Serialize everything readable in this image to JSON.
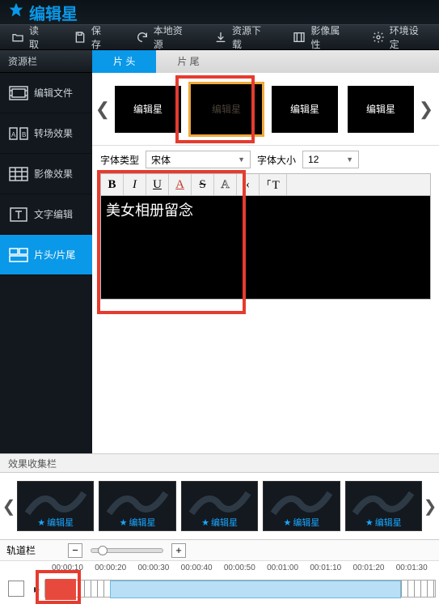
{
  "app": {
    "title": "编辑星"
  },
  "menu": {
    "read": "读 取",
    "save": "保 存",
    "localres": "本地资源",
    "download": "资源下载",
    "movieprops": "影像属性",
    "envset": "环境设定"
  },
  "sidebar": {
    "header": "资源栏",
    "items": [
      {
        "label": "编辑文件"
      },
      {
        "label": "转场效果"
      },
      {
        "label": "影像效果"
      },
      {
        "label": "文字编辑"
      },
      {
        "label": "片头/片尾"
      }
    ]
  },
  "tabs": {
    "head": "片 头",
    "tail": "片 尾"
  },
  "templates": {
    "t0": "编辑星",
    "t1": "编辑星",
    "t2": "编辑星",
    "t3": "编辑星"
  },
  "fontrow": {
    "type_label": "字体类型",
    "type_value": "宋体",
    "size_label": "字体大小",
    "size_value": "12"
  },
  "richtoolbar": {
    "bold": "B",
    "italic": "I",
    "underline": "U",
    "fontA": "A",
    "strike": "S",
    "outlineA": "A",
    "back": "‹",
    "cursor": "⸀T"
  },
  "editor_text": "美女相册留念",
  "fx": {
    "header": "效果收集栏",
    "label": "编辑星"
  },
  "track": {
    "header": "轨道栏",
    "minus": "−",
    "plus": "+",
    "tc": [
      "00:00:10",
      "00:00:20",
      "00:00:30",
      "00:00:40",
      "00:00:50",
      "00:01:00",
      "00:01:10",
      "00:01:20",
      "00:01:30"
    ]
  }
}
